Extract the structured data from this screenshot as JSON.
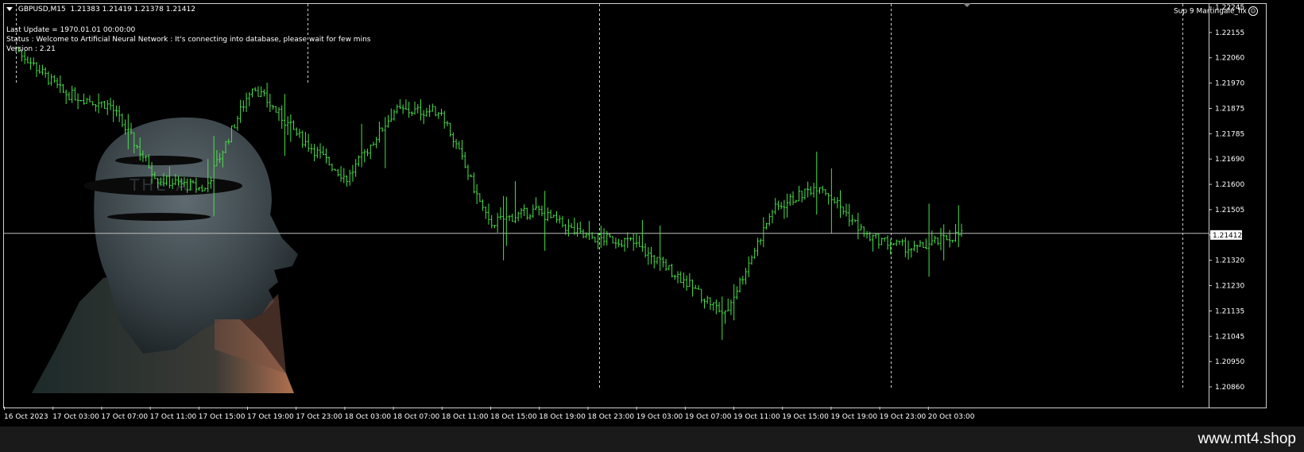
{
  "header": {
    "symbol": "GBPUSD,M15",
    "ohlc": "1.21383 1.21419 1.21378 1.21412"
  },
  "ea": {
    "name": "Sup 9 Martingale_fix",
    "icon": "smiley-icon"
  },
  "info": {
    "last_update": "Last Update = 1970.01.01 00:00:00",
    "status": "Status : Welcome to Artificial Neural Network : It's connecting into database, please wait for few mins",
    "version": "Version : 2.21"
  },
  "background_art": {
    "text": "THE AI"
  },
  "price_axis": {
    "labels": [
      "1.22245",
      "1.22155",
      "1.22060",
      "1.21970",
      "1.21875",
      "1.21785",
      "1.21690",
      "1.21600",
      "1.21505",
      "1.21412",
      "1.21320",
      "1.21230",
      "1.21135",
      "1.21045",
      "1.20950",
      "1.20860"
    ],
    "current_price": "1.21412"
  },
  "time_axis": {
    "labels": [
      "16 Oct 2023",
      "17 Oct 03:00",
      "17 Oct 07:00",
      "17 Oct 11:00",
      "17 Oct 15:00",
      "17 Oct 19:00",
      "17 Oct 23:00",
      "18 Oct 03:00",
      "18 Oct 07:00",
      "18 Oct 11:00",
      "18 Oct 15:00",
      "18 Oct 19:00",
      "18 Oct 23:00",
      "19 Oct 03:00",
      "19 Oct 07:00",
      "19 Oct 11:00",
      "19 Oct 15:00",
      "19 Oct 19:00",
      "19 Oct 23:00",
      "20 Oct 03:00"
    ]
  },
  "colors": {
    "bars": "#48e048",
    "background": "#000000",
    "foreground": "#ffffff",
    "grid": "#cfcfcf"
  },
  "watermark": "www.mt4.shop",
  "chart_data": {
    "type": "ohlc",
    "symbol": "GBPUSD",
    "timeframe": "M15",
    "ylim": [
      1.20815,
      1.2229
    ],
    "x": [
      "16 Oct 2023",
      "17 Oct 03:00",
      "17 Oct 07:00",
      "17 Oct 11:00",
      "17 Oct 15:00",
      "17 Oct 19:00",
      "17 Oct 23:00",
      "18 Oct 03:00",
      "18 Oct 07:00",
      "18 Oct 11:00",
      "18 Oct 15:00",
      "18 Oct 19:00",
      "18 Oct 23:00",
      "19 Oct 03:00",
      "19 Oct 07:00",
      "19 Oct 11:00",
      "19 Oct 15:00",
      "19 Oct 19:00",
      "19 Oct 23:00",
      "20 Oct 03:00",
      "20 Oct 04:45"
    ],
    "y": [
      1.2212,
      1.2195,
      1.219,
      1.2162,
      1.2158,
      1.2198,
      1.2178,
      1.2162,
      1.2188,
      1.2188,
      1.2145,
      1.215,
      1.214,
      1.2138,
      1.2125,
      1.211,
      1.215,
      1.216,
      1.214,
      1.2135,
      1.21412
    ],
    "current_price": 1.21412
  }
}
